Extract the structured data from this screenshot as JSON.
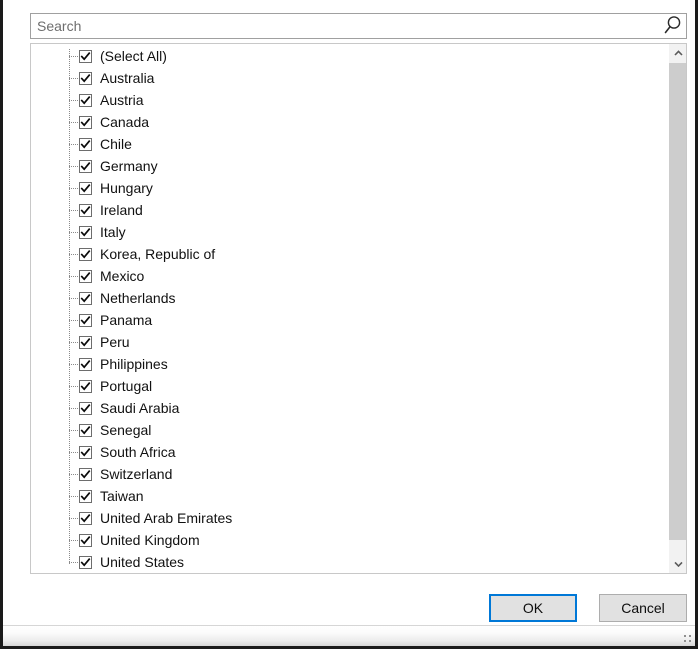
{
  "dialog": {
    "name": "filter-value-picker",
    "accent_color": "#0078d7"
  },
  "search": {
    "placeholder": "Search",
    "value": "",
    "icon": "search-icon"
  },
  "list": {
    "items": [
      {
        "label": "(Select All)",
        "checked": true
      },
      {
        "label": "Australia",
        "checked": true
      },
      {
        "label": "Austria",
        "checked": true
      },
      {
        "label": "Canada",
        "checked": true
      },
      {
        "label": "Chile",
        "checked": true
      },
      {
        "label": "Germany",
        "checked": true
      },
      {
        "label": "Hungary",
        "checked": true
      },
      {
        "label": "Ireland",
        "checked": true
      },
      {
        "label": "Italy",
        "checked": true
      },
      {
        "label": "Korea, Republic of",
        "checked": true
      },
      {
        "label": "Mexico",
        "checked": true
      },
      {
        "label": "Netherlands",
        "checked": true
      },
      {
        "label": "Panama",
        "checked": true
      },
      {
        "label": "Peru",
        "checked": true
      },
      {
        "label": "Philippines",
        "checked": true
      },
      {
        "label": "Portugal",
        "checked": true
      },
      {
        "label": "Saudi Arabia",
        "checked": true
      },
      {
        "label": "Senegal",
        "checked": true
      },
      {
        "label": "South Africa",
        "checked": true
      },
      {
        "label": "Switzerland",
        "checked": true
      },
      {
        "label": "Taiwan",
        "checked": true
      },
      {
        "label": "United Arab Emirates",
        "checked": true
      },
      {
        "label": "United Kingdom",
        "checked": true
      },
      {
        "label": "United States",
        "checked": true
      }
    ]
  },
  "scrollbar": {
    "up_icon": "chevron-up-icon",
    "down_icon": "chevron-down-icon"
  },
  "buttons": {
    "ok_label": "OK",
    "cancel_label": "Cancel"
  },
  "statusbar": {
    "resize_grip_icon": "resize-grip-icon"
  }
}
